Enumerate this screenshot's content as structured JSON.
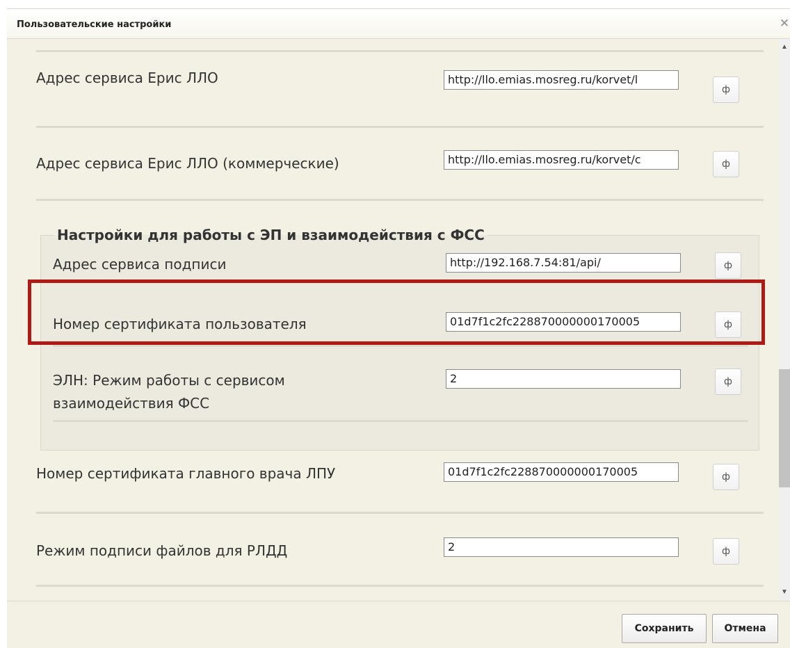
{
  "window": {
    "title": "Пользовательские настройки",
    "close_glyph": "×"
  },
  "settings": {
    "rows": [
      {
        "label": "Адрес сервиса Ерис ЛЛО",
        "value": "http://llo.emias.mosreg.ru/korvet/l"
      },
      {
        "label": "Адрес сервиса Ерис ЛЛО (коммерческие)",
        "value": "http://llo.emias.mosreg.ru/korvet/c"
      },
      {
        "label": "Номер сертификата главного врача ЛПУ",
        "value": "01d7f1c2fc228870000000170005"
      },
      {
        "label": "Режим подписи файлов для РЛДД",
        "value": "2"
      }
    ],
    "group": {
      "title": "Настройки для работы с ЭП и взаимодействия с ФСС",
      "rows": [
        {
          "label": "Адрес сервиса подписи",
          "value": "http://192.168.7.54:81/api/"
        },
        {
          "label": "Номер сертификата пользователя",
          "value": "01d7f1c2fc228870000000170005"
        },
        {
          "label_line1": "ЭЛН: Режим работы с сервисом",
          "label_line2": "взаимодействия ФСС",
          "value": "2"
        }
      ]
    },
    "reset_glyph": "ф"
  },
  "footer": {
    "save_label": "Сохранить",
    "cancel_label": "Отмена"
  },
  "colors": {
    "dialog_bg": "#f3f1e4",
    "group_bg": "#eceade",
    "highlight": "#b01a14"
  },
  "icons": {
    "close": "close-icon",
    "reset": "reset-icon",
    "scroll_up": "triangle-up-icon",
    "scroll_down": "triangle-down-icon"
  }
}
